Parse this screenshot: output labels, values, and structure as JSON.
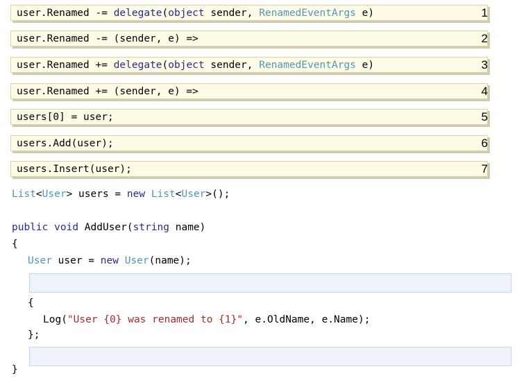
{
  "options": [
    {
      "number": "1",
      "parts": {
        "p1": "user.Renamed -= ",
        "p2": "delegate",
        "p3": "(",
        "p4": "object",
        "p5": " sender, ",
        "p6": "RenamedEventArgs",
        "p7": " e)"
      }
    },
    {
      "number": "2",
      "text": "user.Renamed -= (sender, e) =>"
    },
    {
      "number": "3",
      "parts": {
        "p1": "user.Renamed += ",
        "p2": "delegate",
        "p3": "(",
        "p4": "object",
        "p5": " sender, ",
        "p6": "RenamedEventArgs",
        "p7": " e)"
      }
    },
    {
      "number": "4",
      "text": "user.Renamed += (sender, e) =>"
    },
    {
      "number": "5",
      "text": "users[0] = user;"
    },
    {
      "number": "6",
      "text": "users.Add(user);"
    },
    {
      "number": "7",
      "text": "users.Insert(user);"
    }
  ],
  "code": {
    "line1": {
      "t1": "List",
      "t2": "<",
      "t3": "User",
      "t4": "> users = ",
      "t5": "new",
      "t6": " ",
      "t7": "List",
      "t8": "<",
      "t9": "User",
      "t10": ">();"
    },
    "line2": {
      "t1": "public",
      "t2": " ",
      "t3": "void",
      "t4": " AddUser(",
      "t5": "string",
      "t6": " name)"
    },
    "line3": "{",
    "line4": {
      "t1": "User",
      "t2": " user = ",
      "t3": "new",
      "t4": " ",
      "t5": "User",
      "t6": "(name);"
    },
    "line5": "{",
    "line6": {
      "t1": "Log(",
      "t2": "\"User {0} was renamed to {1}\"",
      "t3": ", e.OldName, e.Name);"
    },
    "line7": "};",
    "line8": "}"
  }
}
